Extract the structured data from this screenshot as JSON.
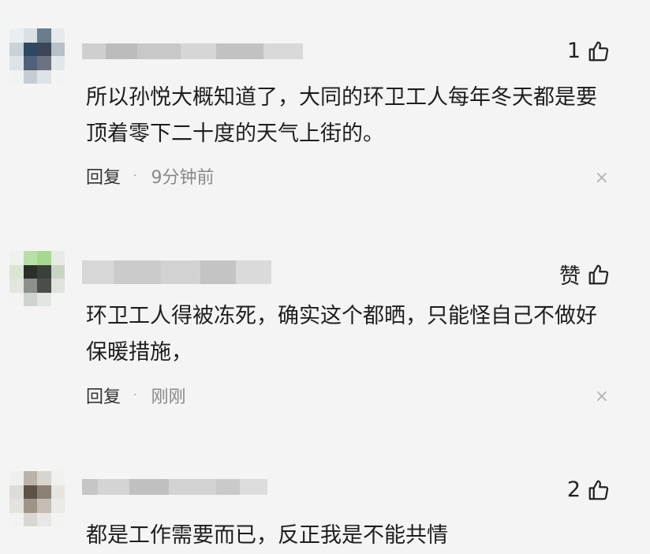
{
  "comments": [
    {
      "like_label": "1",
      "text": "所以孙悦大概知道了，大同的环卫工人每年冬天都是要顶着零下二十度的天气上街的。",
      "reply_label": "回复",
      "time": "9分钟前",
      "close": "×"
    },
    {
      "like_label": "赞",
      "text": "环卫工人得被冻死，确实这个都晒，只能怪自己不做好保暖措施，",
      "reply_label": "回复",
      "time": "刚刚",
      "close": "×"
    },
    {
      "like_label": "2",
      "text": "都是工作需要而已，反正我是不能共情",
      "reply_label": "",
      "time": "",
      "close": ""
    }
  ],
  "separator": "·",
  "icons": {
    "like": "thumbs-up-icon",
    "close": "close-icon"
  }
}
